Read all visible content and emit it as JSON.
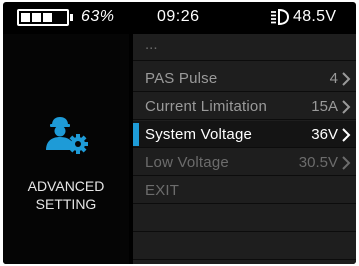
{
  "status_bar": {
    "battery_percent": "63%",
    "battery_level": 0.63,
    "time": "09:26",
    "headlight_icon": "headlight-icon",
    "voltage": "48.5V"
  },
  "left_panel": {
    "icon": "user-settings-icon",
    "title_line1": "ADVANCED",
    "title_line2": "SETTING",
    "icon_color": "#1e9bd7"
  },
  "menu": {
    "more_indicator": "...",
    "items": [
      {
        "label": "PAS Pulse",
        "value": "4"
      },
      {
        "label": "Current Limitation",
        "value": "15A"
      },
      {
        "label": "System Voltage",
        "value": "36V"
      },
      {
        "label": "Low Voltage",
        "value": "30.5V"
      },
      {
        "label": "EXIT",
        "value": ""
      }
    ],
    "selected_index": 2,
    "accent_color": "#1e9bd7"
  }
}
